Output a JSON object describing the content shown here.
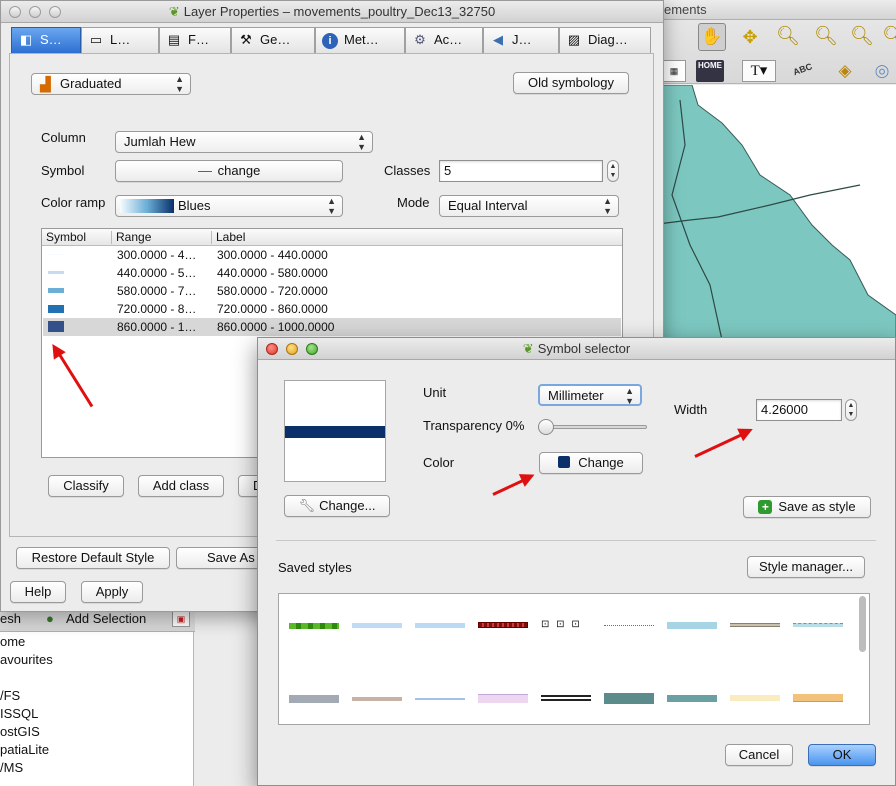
{
  "layer_window": {
    "title": "Layer Properties – movements_poultry_Dec13_32750",
    "tabs": [
      {
        "label": "S…",
        "icon": "style-icon"
      },
      {
        "label": "L…",
        "icon": "labels-icon"
      },
      {
        "label": "F…",
        "icon": "fields-icon"
      },
      {
        "label": "Ge…",
        "icon": "tools-icon"
      },
      {
        "label": "Met…",
        "icon": "info-icon"
      },
      {
        "label": "Ac…",
        "icon": "actions-icon"
      },
      {
        "label": "J…",
        "icon": "joins-icon"
      },
      {
        "label": "Diag…",
        "icon": "diagram-icon"
      }
    ],
    "renderer_combo": "Graduated",
    "old_symbology_button": "Old symbology",
    "column_label": "Column",
    "column_value": "Jumlah Hew",
    "symbol_label": "Symbol",
    "symbol_change_button": "change",
    "classes_label": "Classes",
    "classes_value": "5",
    "color_ramp_label": "Color ramp",
    "color_ramp_value": "Blues",
    "mode_label": "Mode",
    "mode_value": "Equal Interval",
    "table_headers": [
      "Symbol",
      "Range",
      "Label"
    ],
    "table_rows": [
      {
        "range": "300.0000 - 4…",
        "label": "300.0000 - 440.0000",
        "color": "#f7fbff",
        "thickness": 1
      },
      {
        "range": "440.0000 - 5…",
        "label": "440.0000 - 580.0000",
        "color": "#c6dbef",
        "thickness": 3
      },
      {
        "range": "580.0000 - 7…",
        "label": "580.0000 - 720.0000",
        "color": "#6baed6",
        "thickness": 5
      },
      {
        "range": "720.0000 - 8…",
        "label": "720.0000 - 860.0000",
        "color": "#2171b5",
        "thickness": 8
      },
      {
        "range": "860.0000 - 1…",
        "label": "860.0000 - 1000.0000",
        "color": "#33508a",
        "thickness": 11
      }
    ],
    "classify_button": "Classify",
    "add_class_button": "Add class",
    "delete_button_partial": "D",
    "restore_button": "Restore Default Style",
    "save_as_button": "Save As",
    "help_button": "Help",
    "apply_button": "Apply"
  },
  "background": {
    "map_window_title_fragment": "ements",
    "browser_toolbar": {
      "refresh_fragment": "esh",
      "add_selection": "Add Selection"
    },
    "browser_items": [
      "ome",
      "avourites",
      "",
      "/FS",
      "ISSQL",
      "ostGIS",
      "patiaLite",
      "/MS"
    ],
    "map_fill_color": "#7cc8c0",
    "home_label": "HOME",
    "abc_label": "ABC"
  },
  "symbol_selector": {
    "title": "Symbol selector",
    "preview_color": "#0a2f6b",
    "preview_change_button": "Change...",
    "unit_label": "Unit",
    "unit_value": "Millimeter",
    "transparency_label": "Transparency 0%",
    "transparency_percent": 0,
    "color_label": "Color",
    "color_button": "Change",
    "color_swatch": "#0a2f6b",
    "width_label": "Width",
    "width_value": "4.26000",
    "save_as_style_button": "Save as style",
    "saved_styles_label": "Saved styles",
    "style_manager_button": "Style manager...",
    "cancel_button": "Cancel",
    "ok_button": "OK"
  }
}
